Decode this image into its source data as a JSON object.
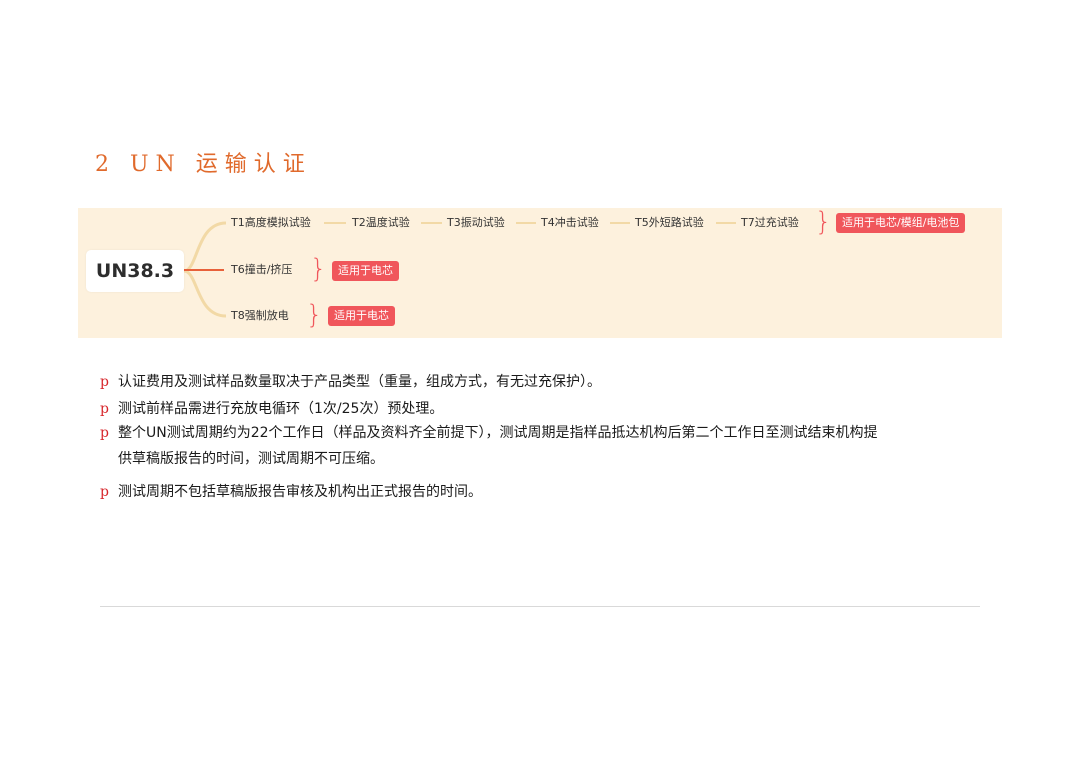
{
  "section": {
    "title": "2 UN 运输认证"
  },
  "mindmap": {
    "root": "UN38.3",
    "row1": {
      "nodes": [
        "T1高度模拟试验",
        "T2温度试验",
        "T3振动试验",
        "T4冲击试验",
        "T5外短路试验",
        "T7过充试验"
      ],
      "tag": "适用于电芯/模组/电池包"
    },
    "row2": {
      "nodes": [
        "T6撞击/挤压"
      ],
      "tag": "适用于电芯"
    },
    "row3": {
      "nodes": [
        "T8强制放电"
      ],
      "tag": "适用于电芯"
    },
    "colors": {
      "branch": "#f2d9a6",
      "accent_line": "#e8613a",
      "tag": "#f0565b",
      "background": "#fdf1dd"
    }
  },
  "bullets": {
    "marker": "p",
    "items": [
      {
        "line1": "认证费用及测试样品数量取决于产品类型（重量，组成方式，有无过充保护）。"
      },
      {
        "line1": "测试前样品需进行充放电循环（1次/25次）预处理。"
      },
      {
        "line1": "整个UN测试周期约为22个工作日（样品及资料齐全前提下），测试周期是指样品抵达机构后第二个工作日至测试结束机构提",
        "line2": "供草稿版报告的时间，测试周期不可压缩。"
      },
      {
        "line1": "测试周期不包括草稿版报告审核及机构出正式报告的时间。"
      }
    ]
  }
}
